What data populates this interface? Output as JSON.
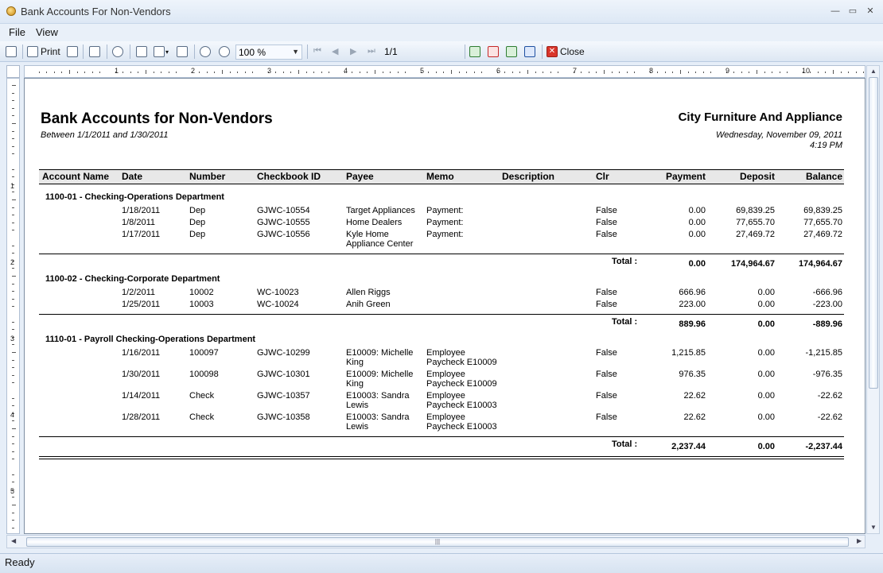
{
  "window": {
    "title": "Bank Accounts For Non-Vendors",
    "minimize": "—",
    "maximize": "▭",
    "close": "✕"
  },
  "menu": [
    "File",
    "View"
  ],
  "toolbar": {
    "print_label": "Print",
    "zoom": "100 %",
    "page": "1/1",
    "close_label": "Close"
  },
  "status": "Ready",
  "report": {
    "title": "Bank Accounts for Non-Vendors",
    "subtitle": "Between 1/1/2011 and 1/30/2011",
    "company": "City Furniture And Appliance",
    "date": "Wednesday, November 09, 2011",
    "time": "4:19 PM",
    "columns": [
      "Account Name",
      "Date",
      "Number",
      "Checkbook ID",
      "Payee",
      "Memo",
      "Description",
      "Clr",
      "Payment",
      "Deposit",
      "Balance"
    ],
    "total_label": "Total :",
    "groups": [
      {
        "name": "1100-01 - Checking-Operations Department",
        "rows": [
          {
            "date": "1/18/2011",
            "number": "Dep",
            "checkbook": "GJWC-10554",
            "payee": [
              "Target Appliances"
            ],
            "memo": [
              "Payment:"
            ],
            "clr": "False",
            "payment": "0.00",
            "deposit": "69,839.25",
            "balance": "69,839.25"
          },
          {
            "date": "1/8/2011",
            "number": "Dep",
            "checkbook": "GJWC-10555",
            "payee": [
              "Home Dealers"
            ],
            "memo": [
              "Payment:"
            ],
            "clr": "False",
            "payment": "0.00",
            "deposit": "77,655.70",
            "balance": "77,655.70"
          },
          {
            "date": "1/17/2011",
            "number": "Dep",
            "checkbook": "GJWC-10556",
            "payee": [
              "Kyle Home",
              "Appliance Center"
            ],
            "memo": [
              "Payment:"
            ],
            "clr": "False",
            "payment": "0.00",
            "deposit": "27,469.72",
            "balance": "27,469.72"
          }
        ],
        "total": {
          "payment": "0.00",
          "deposit": "174,964.67",
          "balance": "174,964.67"
        }
      },
      {
        "name": "1100-02 - Checking-Corporate Department",
        "rows": [
          {
            "date": "1/2/2011",
            "number": "10002",
            "checkbook": "WC-10023",
            "payee": [
              "Allen Riggs"
            ],
            "memo": [
              ""
            ],
            "clr": "False",
            "payment": "666.96",
            "deposit": "0.00",
            "balance": "-666.96"
          },
          {
            "date": "1/25/2011",
            "number": "10003",
            "checkbook": "WC-10024",
            "payee": [
              "Anih Green"
            ],
            "memo": [
              ""
            ],
            "clr": "False",
            "payment": "223.00",
            "deposit": "0.00",
            "balance": "-223.00"
          }
        ],
        "total": {
          "payment": "889.96",
          "deposit": "0.00",
          "balance": "-889.96"
        }
      },
      {
        "name": "1110-01 - Payroll Checking-Operations Department",
        "rows": [
          {
            "date": "1/16/2011",
            "number": "100097",
            "checkbook": "GJWC-10299",
            "payee": [
              "E10009: Michelle",
              "King"
            ],
            "memo": [
              "Employee",
              "Paycheck E10009"
            ],
            "clr": "False",
            "payment": "1,215.85",
            "deposit": "0.00",
            "balance": "-1,215.85"
          },
          {
            "date": "1/30/2011",
            "number": "100098",
            "checkbook": "GJWC-10301",
            "payee": [
              "E10009: Michelle",
              "King"
            ],
            "memo": [
              "Employee",
              "Paycheck E10009"
            ],
            "clr": "False",
            "payment": "976.35",
            "deposit": "0.00",
            "balance": "-976.35"
          },
          {
            "date": "1/14/2011",
            "number": "Check",
            "checkbook": "GJWC-10357",
            "payee": [
              "E10003: Sandra",
              "Lewis"
            ],
            "memo": [
              "Employee",
              "Paycheck E10003"
            ],
            "clr": "False",
            "payment": "22.62",
            "deposit": "0.00",
            "balance": "-22.62"
          },
          {
            "date": "1/28/2011",
            "number": "Check",
            "checkbook": "GJWC-10358",
            "payee": [
              "E10003: Sandra",
              "Lewis"
            ],
            "memo": [
              "Employee",
              "Paycheck E10003"
            ],
            "clr": "False",
            "payment": "22.62",
            "deposit": "0.00",
            "balance": "-22.62"
          }
        ],
        "total": {
          "payment": "2,237.44",
          "deposit": "0.00",
          "balance": "-2,237.44"
        }
      }
    ]
  },
  "ruler_numbers_top": [
    "1",
    "2",
    "3",
    "4",
    "5",
    "6",
    "7",
    "8",
    "9",
    "10"
  ],
  "ruler_numbers_left": [
    "1",
    "2",
    "3",
    "4",
    "5"
  ]
}
